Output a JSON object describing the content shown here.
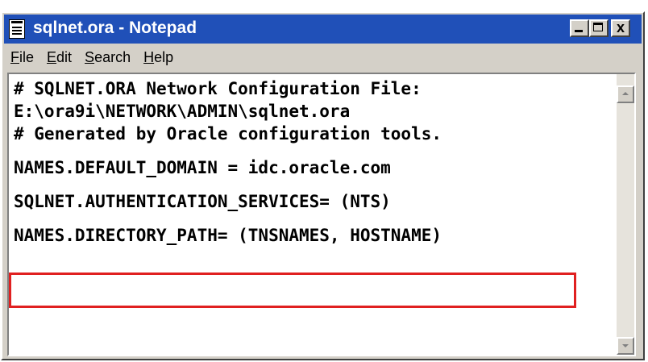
{
  "window": {
    "title": "sqlnet.ora - Notepad",
    "close_glyph": "x"
  },
  "menu": {
    "file": "File",
    "edit": "Edit",
    "search": "Search",
    "help": "Help"
  },
  "editor": {
    "lines": [
      "# SQLNET.ORA Network Configuration File:",
      "E:\\ora9i\\NETWORK\\ADMIN\\sqlnet.ora",
      "# Generated by Oracle configuration tools.",
      "NAMES.DEFAULT_DOMAIN = idc.oracle.com",
      "SQLNET.AUTHENTICATION_SERVICES= (NTS)",
      "NAMES.DIRECTORY_PATH= (TNSNAMES, HOSTNAME)"
    ]
  },
  "colors": {
    "titlebar": "#2050b8",
    "highlight": "#e02020"
  },
  "icons": {
    "app": "notepad-icon",
    "scroll_up": "arrow-up-icon",
    "scroll_down": "arrow-down-icon"
  }
}
